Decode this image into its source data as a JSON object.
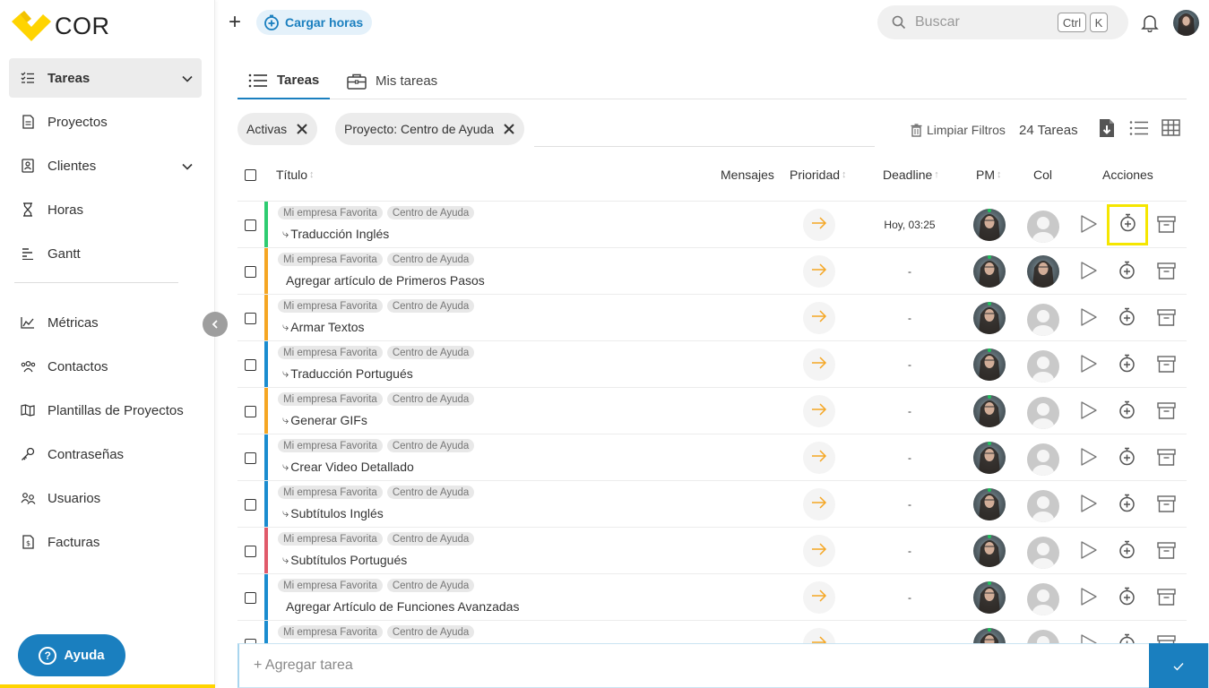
{
  "app": {
    "logo_text": "COR",
    "brand_color": "#ffd400",
    "accent_color": "#1a7fbf"
  },
  "sidebar": {
    "items": [
      {
        "label": "Tareas",
        "icon": "tasks-icon",
        "active": true,
        "expandable": true
      },
      {
        "label": "Proyectos",
        "icon": "document-icon"
      },
      {
        "label": "Clientes",
        "icon": "contact-card-icon",
        "expandable": true
      },
      {
        "label": "Horas",
        "icon": "hourglass-icon"
      },
      {
        "label": "Gantt",
        "icon": "gantt-icon"
      },
      {
        "label": "Métricas",
        "icon": "chart-icon"
      },
      {
        "label": "Contactos",
        "icon": "people-icon"
      },
      {
        "label": "Plantillas de Proyectos",
        "icon": "map-icon"
      },
      {
        "label": "Contraseñas",
        "icon": "key-icon"
      },
      {
        "label": "Usuarios",
        "icon": "users-icon"
      },
      {
        "label": "Facturas",
        "icon": "invoice-icon"
      }
    ],
    "help_label": "Ayuda"
  },
  "topbar": {
    "cargar_label": "Cargar horas",
    "search_placeholder": "Buscar",
    "shortcut_ctrl": "Ctrl",
    "shortcut_k": "K"
  },
  "tabs": [
    {
      "label": "Tareas",
      "active": true
    },
    {
      "label": "Mis tareas",
      "active": false
    }
  ],
  "filters": {
    "chips": [
      "Activas",
      "Proyecto: Centro de Ayuda"
    ],
    "clear_label": "Limpiar Filtros",
    "count_label": "24 Tareas"
  },
  "table": {
    "headers": {
      "title": "Título",
      "messages": "Mensajes",
      "priority": "Prioridad",
      "deadline": "Deadline",
      "pm": "PM",
      "col": "Col",
      "actions": "Acciones"
    },
    "rows": [
      {
        "tags": [
          "Mi empresa Favorita",
          "Centro de Ayuda"
        ],
        "title": "Traducción Inglés",
        "subtask": true,
        "deadline": "Hoy, 03:25",
        "color": "#2ecc71",
        "col_photo": false
      },
      {
        "tags": [
          "Mi empresa Favorita",
          "Centro de Ayuda"
        ],
        "title": "Agregar artículo de Primeros Pasos",
        "subtask": false,
        "deadline": "-",
        "color": "#f5a623",
        "col_photo": true
      },
      {
        "tags": [
          "Mi empresa Favorita",
          "Centro de Ayuda"
        ],
        "title": "Armar Textos",
        "subtask": true,
        "deadline": "-",
        "color": "#f5a623",
        "col_photo": false
      },
      {
        "tags": [
          "Mi empresa Favorita",
          "Centro de Ayuda"
        ],
        "title": "Traducción Portugués",
        "subtask": true,
        "deadline": "-",
        "color": "#1a8ccf",
        "col_photo": false
      },
      {
        "tags": [
          "Mi empresa Favorita",
          "Centro de Ayuda"
        ],
        "title": "Generar GIFs",
        "subtask": true,
        "deadline": "-",
        "color": "#f5a623",
        "col_photo": false
      },
      {
        "tags": [
          "Mi empresa Favorita",
          "Centro de Ayuda"
        ],
        "title": "Crear Video Detallado",
        "subtask": true,
        "deadline": "-",
        "color": "#1a8ccf",
        "col_photo": false
      },
      {
        "tags": [
          "Mi empresa Favorita",
          "Centro de Ayuda"
        ],
        "title": "Subtítulos Inglés",
        "subtask": true,
        "deadline": "-",
        "color": "#1a8ccf",
        "col_photo": false
      },
      {
        "tags": [
          "Mi empresa Favorita",
          "Centro de Ayuda"
        ],
        "title": "Subtítulos Portugués",
        "subtask": true,
        "deadline": "-",
        "color": "#e05a6a",
        "col_photo": false
      },
      {
        "tags": [
          "Mi empresa Favorita",
          "Centro de Ayuda"
        ],
        "title": "Agregar Artículo de Funciones Avanzadas",
        "subtask": false,
        "deadline": "-",
        "color": "#1a8ccf",
        "col_photo": false
      },
      {
        "tags": [
          "Mi empresa Favorita",
          "Centro de Ayuda"
        ],
        "title": "",
        "subtask": false,
        "deadline": "",
        "color": "#1a8ccf",
        "col_photo": false
      }
    ]
  },
  "add_task": {
    "placeholder": "+ Agregar tarea"
  }
}
